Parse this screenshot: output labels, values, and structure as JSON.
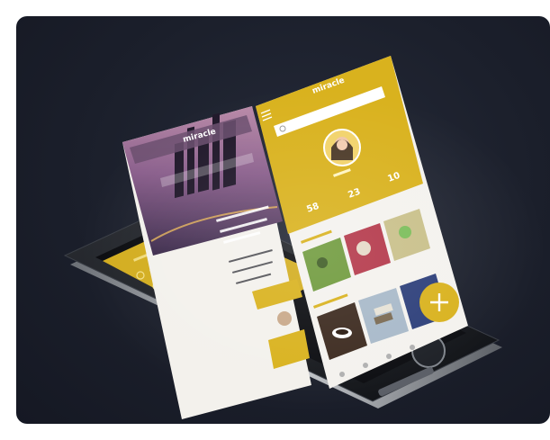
{
  "image": {
    "subject": "smartphone app mockup",
    "colors": {
      "background": "#1b1f2b",
      "accent_yellow": "#d9b21e",
      "phone_body": "#15171c",
      "phone_edge": "#9ea2a8"
    }
  },
  "front_screen": {
    "logo": "miracle",
    "stats": [
      "58",
      "23",
      "10"
    ],
    "fab_icon": "plus-icon"
  },
  "back_screen": {
    "logo": "miracle",
    "image": "city-night-skyline"
  }
}
